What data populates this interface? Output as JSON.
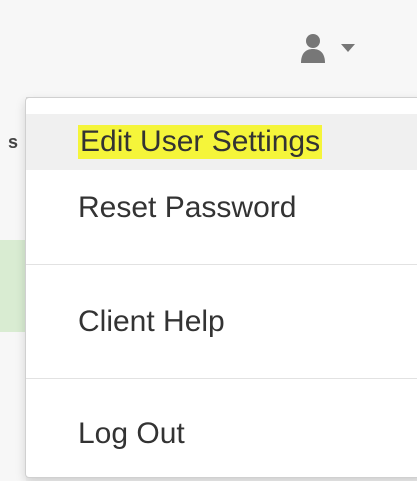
{
  "navbar": {
    "user_icon": "user-icon",
    "caret_icon": "caret-down-icon"
  },
  "background": {
    "edge_glyph": "s"
  },
  "menu": {
    "items": [
      {
        "label": "Edit User Settings"
      },
      {
        "label": "Reset Password"
      },
      {
        "label": "Client Help"
      },
      {
        "label": "Log Out"
      }
    ]
  },
  "colors": {
    "highlight": "#f5f53a",
    "text": "#333333",
    "icon": "#777777"
  }
}
